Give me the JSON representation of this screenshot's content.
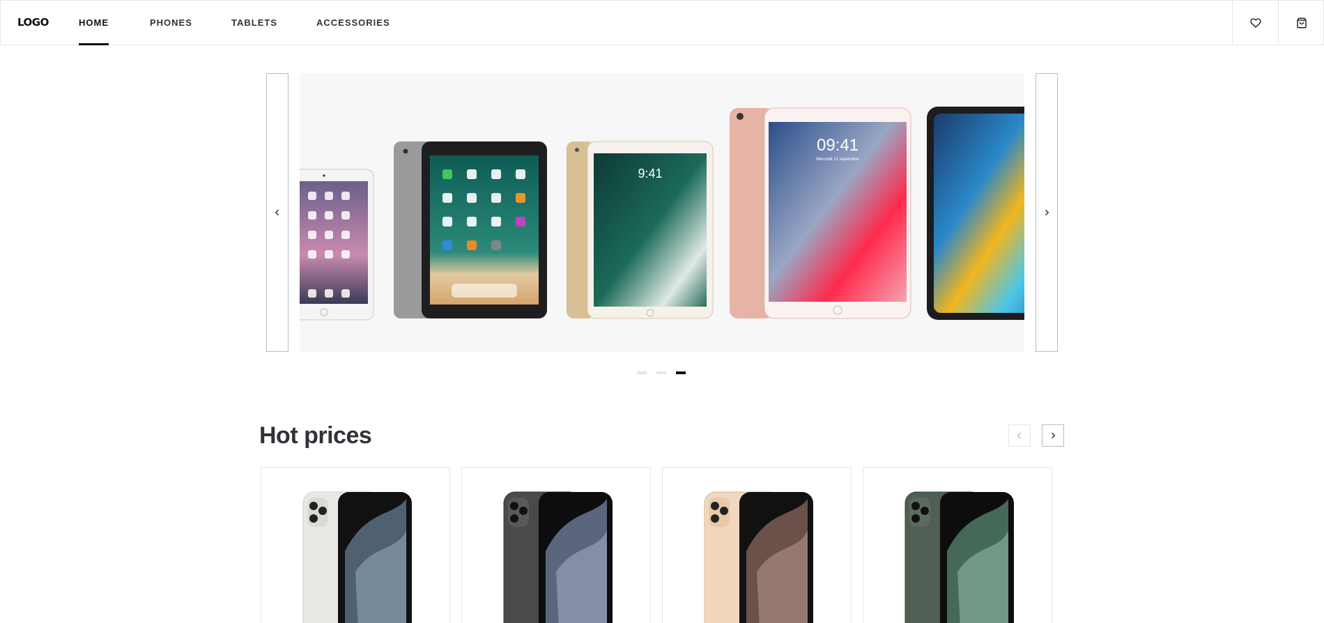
{
  "header": {
    "logo": "LOGO",
    "nav": [
      {
        "label": "HOME",
        "active": true
      },
      {
        "label": "PHONES",
        "active": false
      },
      {
        "label": "TABLETS",
        "active": false
      },
      {
        "label": "ACCESSORIES",
        "active": false
      }
    ],
    "actions": [
      {
        "icon": "heart-icon"
      },
      {
        "icon": "shopping-bag-icon"
      }
    ]
  },
  "banner": {
    "slides_total": 3,
    "active_slide": 3,
    "products": [
      {
        "name": "iPad mini",
        "color": "#e8e6e6"
      },
      {
        "name": "iPad 9.7 space gray",
        "color": "#3a3a3c"
      },
      {
        "name": "iPad Pro gold",
        "color": "#e6cfae",
        "time": "9:41"
      },
      {
        "name": "iPad Pro rose gold",
        "color": "#e8b7ae",
        "time": "09:41",
        "date": "Mercredi 12 septembre"
      },
      {
        "name": "iPad Pro 11",
        "color": "#1c1c1e"
      }
    ],
    "prev_icon": "chevron-left-icon",
    "next_icon": "chevron-right-icon"
  },
  "hot_prices": {
    "title": "Hot prices",
    "prev_disabled": true,
    "products": [
      {
        "name": "iPhone 11 Pro silver",
        "color": "#e9e8e3"
      },
      {
        "name": "iPhone 11 Pro space gray",
        "color": "#4b4a48"
      },
      {
        "name": "iPhone 11 Pro gold",
        "color": "#f1d7bd"
      },
      {
        "name": "iPhone 11 Pro midnight green",
        "color": "#4f5f54"
      }
    ]
  }
}
